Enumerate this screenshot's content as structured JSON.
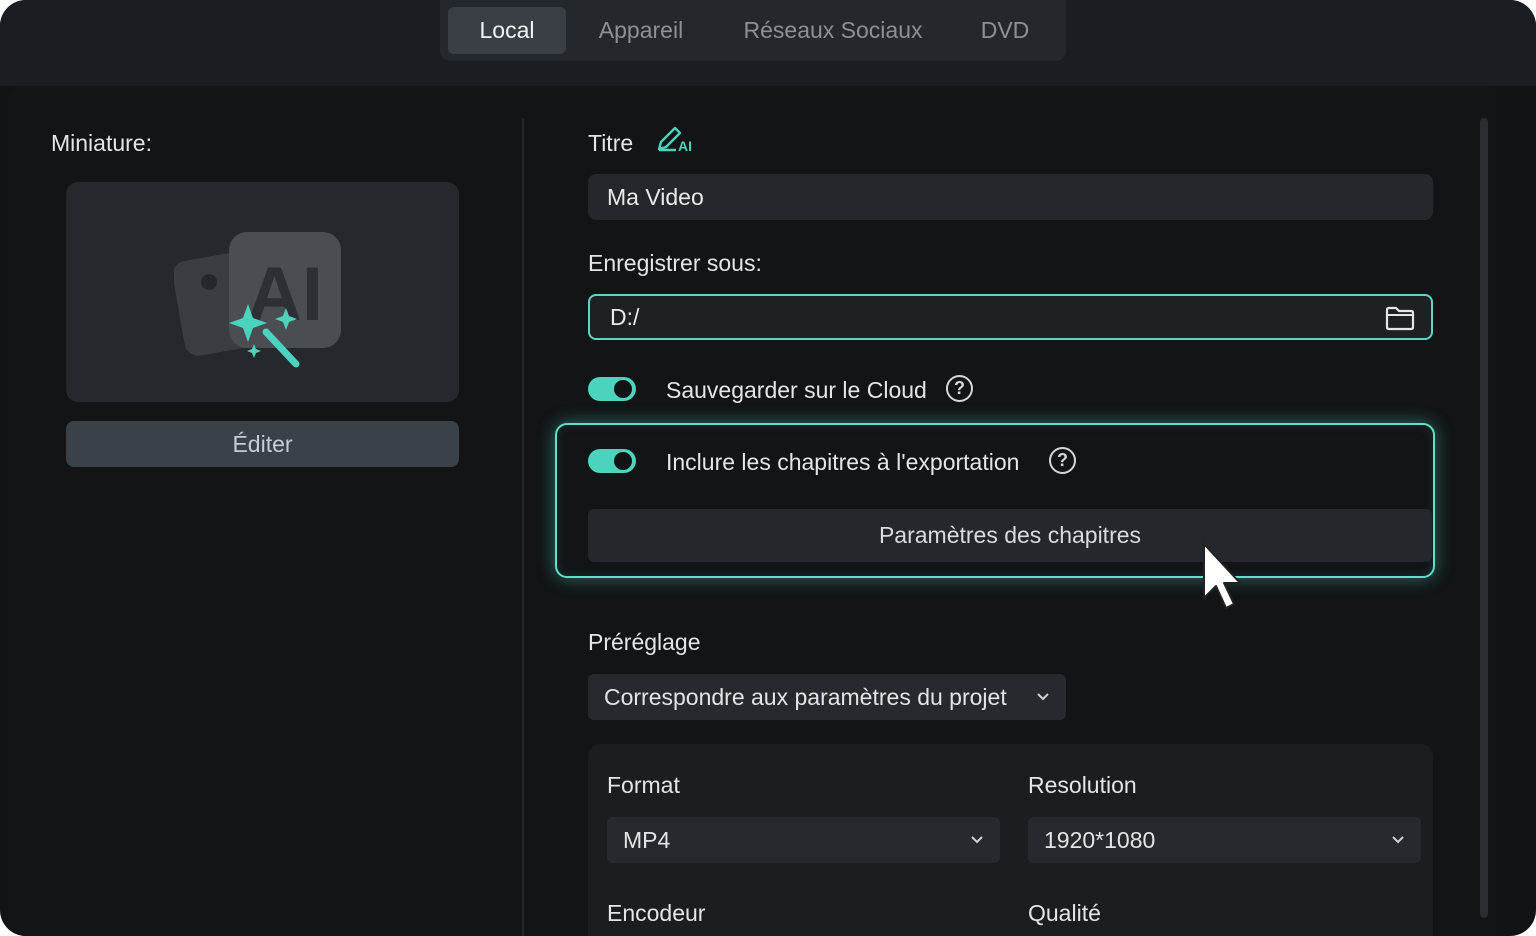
{
  "tabs": {
    "local": "Local",
    "appareil": "Appareil",
    "reseaux": "Réseaux Sociaux",
    "dvd": "DVD"
  },
  "left": {
    "thumbnail_label": "Miniature:",
    "edit_button": "Éditer",
    "thumbnail_art_text": "AI"
  },
  "form": {
    "title_label": "Titre",
    "title_ai_icon_text": "AI",
    "title_value": "Ma Video",
    "save_as_label": "Enregistrer sous:",
    "save_path": "D:/",
    "cloud_toggle_label": "Sauvegarder sur le Cloud",
    "chapters_toggle_label": "Inclure les chapitres à l'exportation",
    "chapters_settings_button": "Paramètres des chapitres",
    "help_glyph": "?",
    "preset_label": "Préréglage",
    "preset_value": "Correspondre aux paramètres du projet",
    "format_label": "Format",
    "format_value": "MP4",
    "resolution_label": "Resolution",
    "resolution_value": "1920*1080",
    "encoder_label": "Encodeur",
    "quality_label": "Qualité"
  },
  "state": {
    "cloud_toggle_on": true,
    "chapters_toggle_on": true
  },
  "colors": {
    "accent": "#4cd3be",
    "background": "#111315",
    "panel": "#24272b"
  },
  "icons": {
    "ai_title": "ai-pen-icon",
    "folder": "folder-icon",
    "help": "help-icon",
    "chevron": "chevron-down-icon",
    "cursor": "mouse-pointer-icon",
    "thumbnail": "ai-image-magic-wand-icon"
  }
}
